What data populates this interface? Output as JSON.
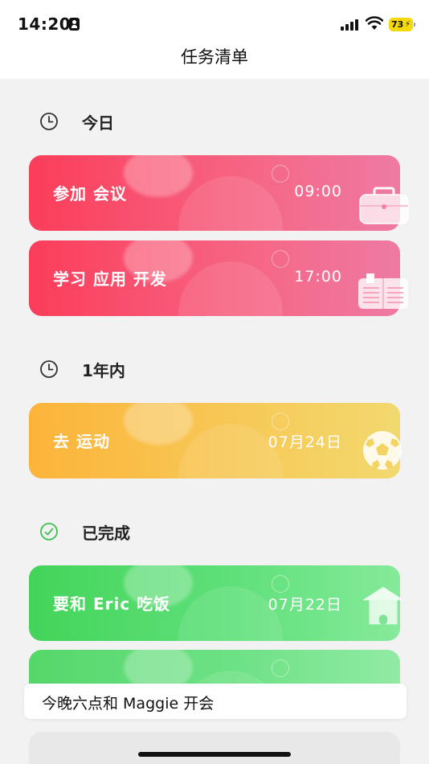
{
  "status_bar": {
    "time": "14:20",
    "battery": "73"
  },
  "nav": {
    "title": "任务清单"
  },
  "sections": {
    "today": {
      "title": "今日",
      "icon": "clock-icon"
    },
    "year": {
      "title": "1年内",
      "icon": "clock-icon"
    },
    "done": {
      "title": "已完成",
      "icon": "check-circle-icon"
    }
  },
  "tasks": {
    "meeting": {
      "label": "参加 会议",
      "when": "09:00",
      "icon": "briefcase-icon",
      "color": "#fb3d5a"
    },
    "study": {
      "label": "学习 应用 开发",
      "when": "17:00",
      "icon": "book-icon",
      "color": "#fb3d5a"
    },
    "sport": {
      "label": "去 运动",
      "when": "07月24日",
      "icon": "soccer-ball-icon",
      "color": "#fcb43a"
    },
    "dinner": {
      "label": "要和 Eric 吃饭",
      "when": "07月22日",
      "icon": "house-icon",
      "color": "#44d45a"
    }
  },
  "suggestion": {
    "text": "今晚六点和 Maggie 开会"
  }
}
